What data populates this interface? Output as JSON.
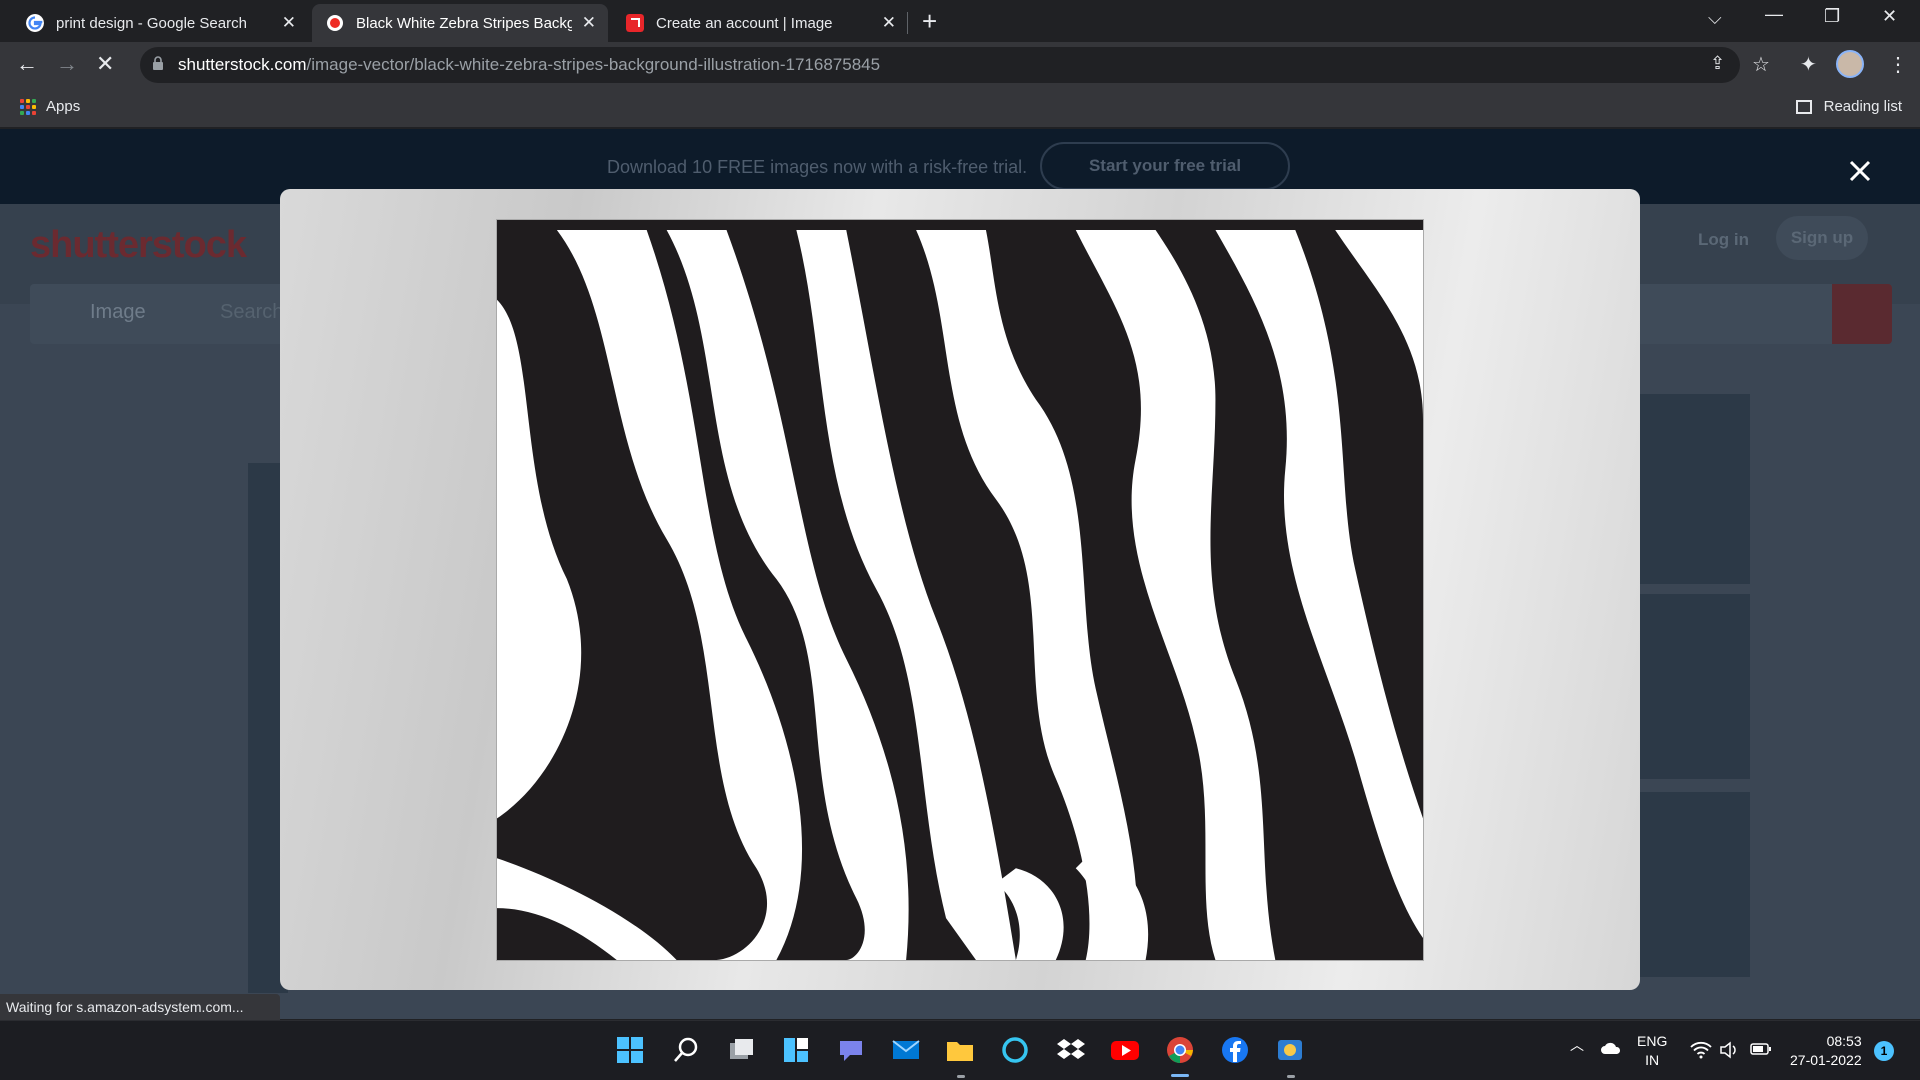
{
  "tabs": [
    {
      "title": "print design - Google Search",
      "favicon": "google-icon",
      "active": false
    },
    {
      "title": "Black White Zebra Stripes Backgr",
      "favicon": "shutterstock-icon",
      "active": true
    },
    {
      "title": "Create an account | Image",
      "favicon": "adobe-express-icon",
      "active": false
    }
  ],
  "omnibox": {
    "host": "shutterstock.com",
    "path": "/image-vector/black-white-zebra-stripes-background-illustration-1716875845"
  },
  "bookmarks": {
    "apps_label": "Apps",
    "reading_list_label": "Reading list"
  },
  "page": {
    "promo_text": "Download 10 FREE images now with a risk-free trial.",
    "promo_button": "Start your free trial",
    "logo": "shutterstock",
    "login": "Log in",
    "signup": "Sign up",
    "search_type": "Image",
    "search_placeholder": "Search"
  },
  "status_text": "Waiting for s.amazon-adsystem.com...",
  "taskbar": {
    "apps": [
      "start-icon",
      "search-icon",
      "task-view-icon",
      "widgets-icon",
      "teams-chat-icon",
      "mail-icon",
      "file-explorer-icon",
      "cortana-icon",
      "dropbox-icon",
      "youtube-icon",
      "chrome-icon",
      "facebook-icon",
      "photos-icon"
    ],
    "language": "ENG",
    "region": "IN",
    "time": "08:53",
    "date": "27-01-2022",
    "notifications": "1"
  },
  "colors": {
    "chrome_dark": "#202124",
    "chrome_toolbar": "#35363a",
    "accent": "#8ab4f8",
    "brand": "#ee2b24"
  }
}
